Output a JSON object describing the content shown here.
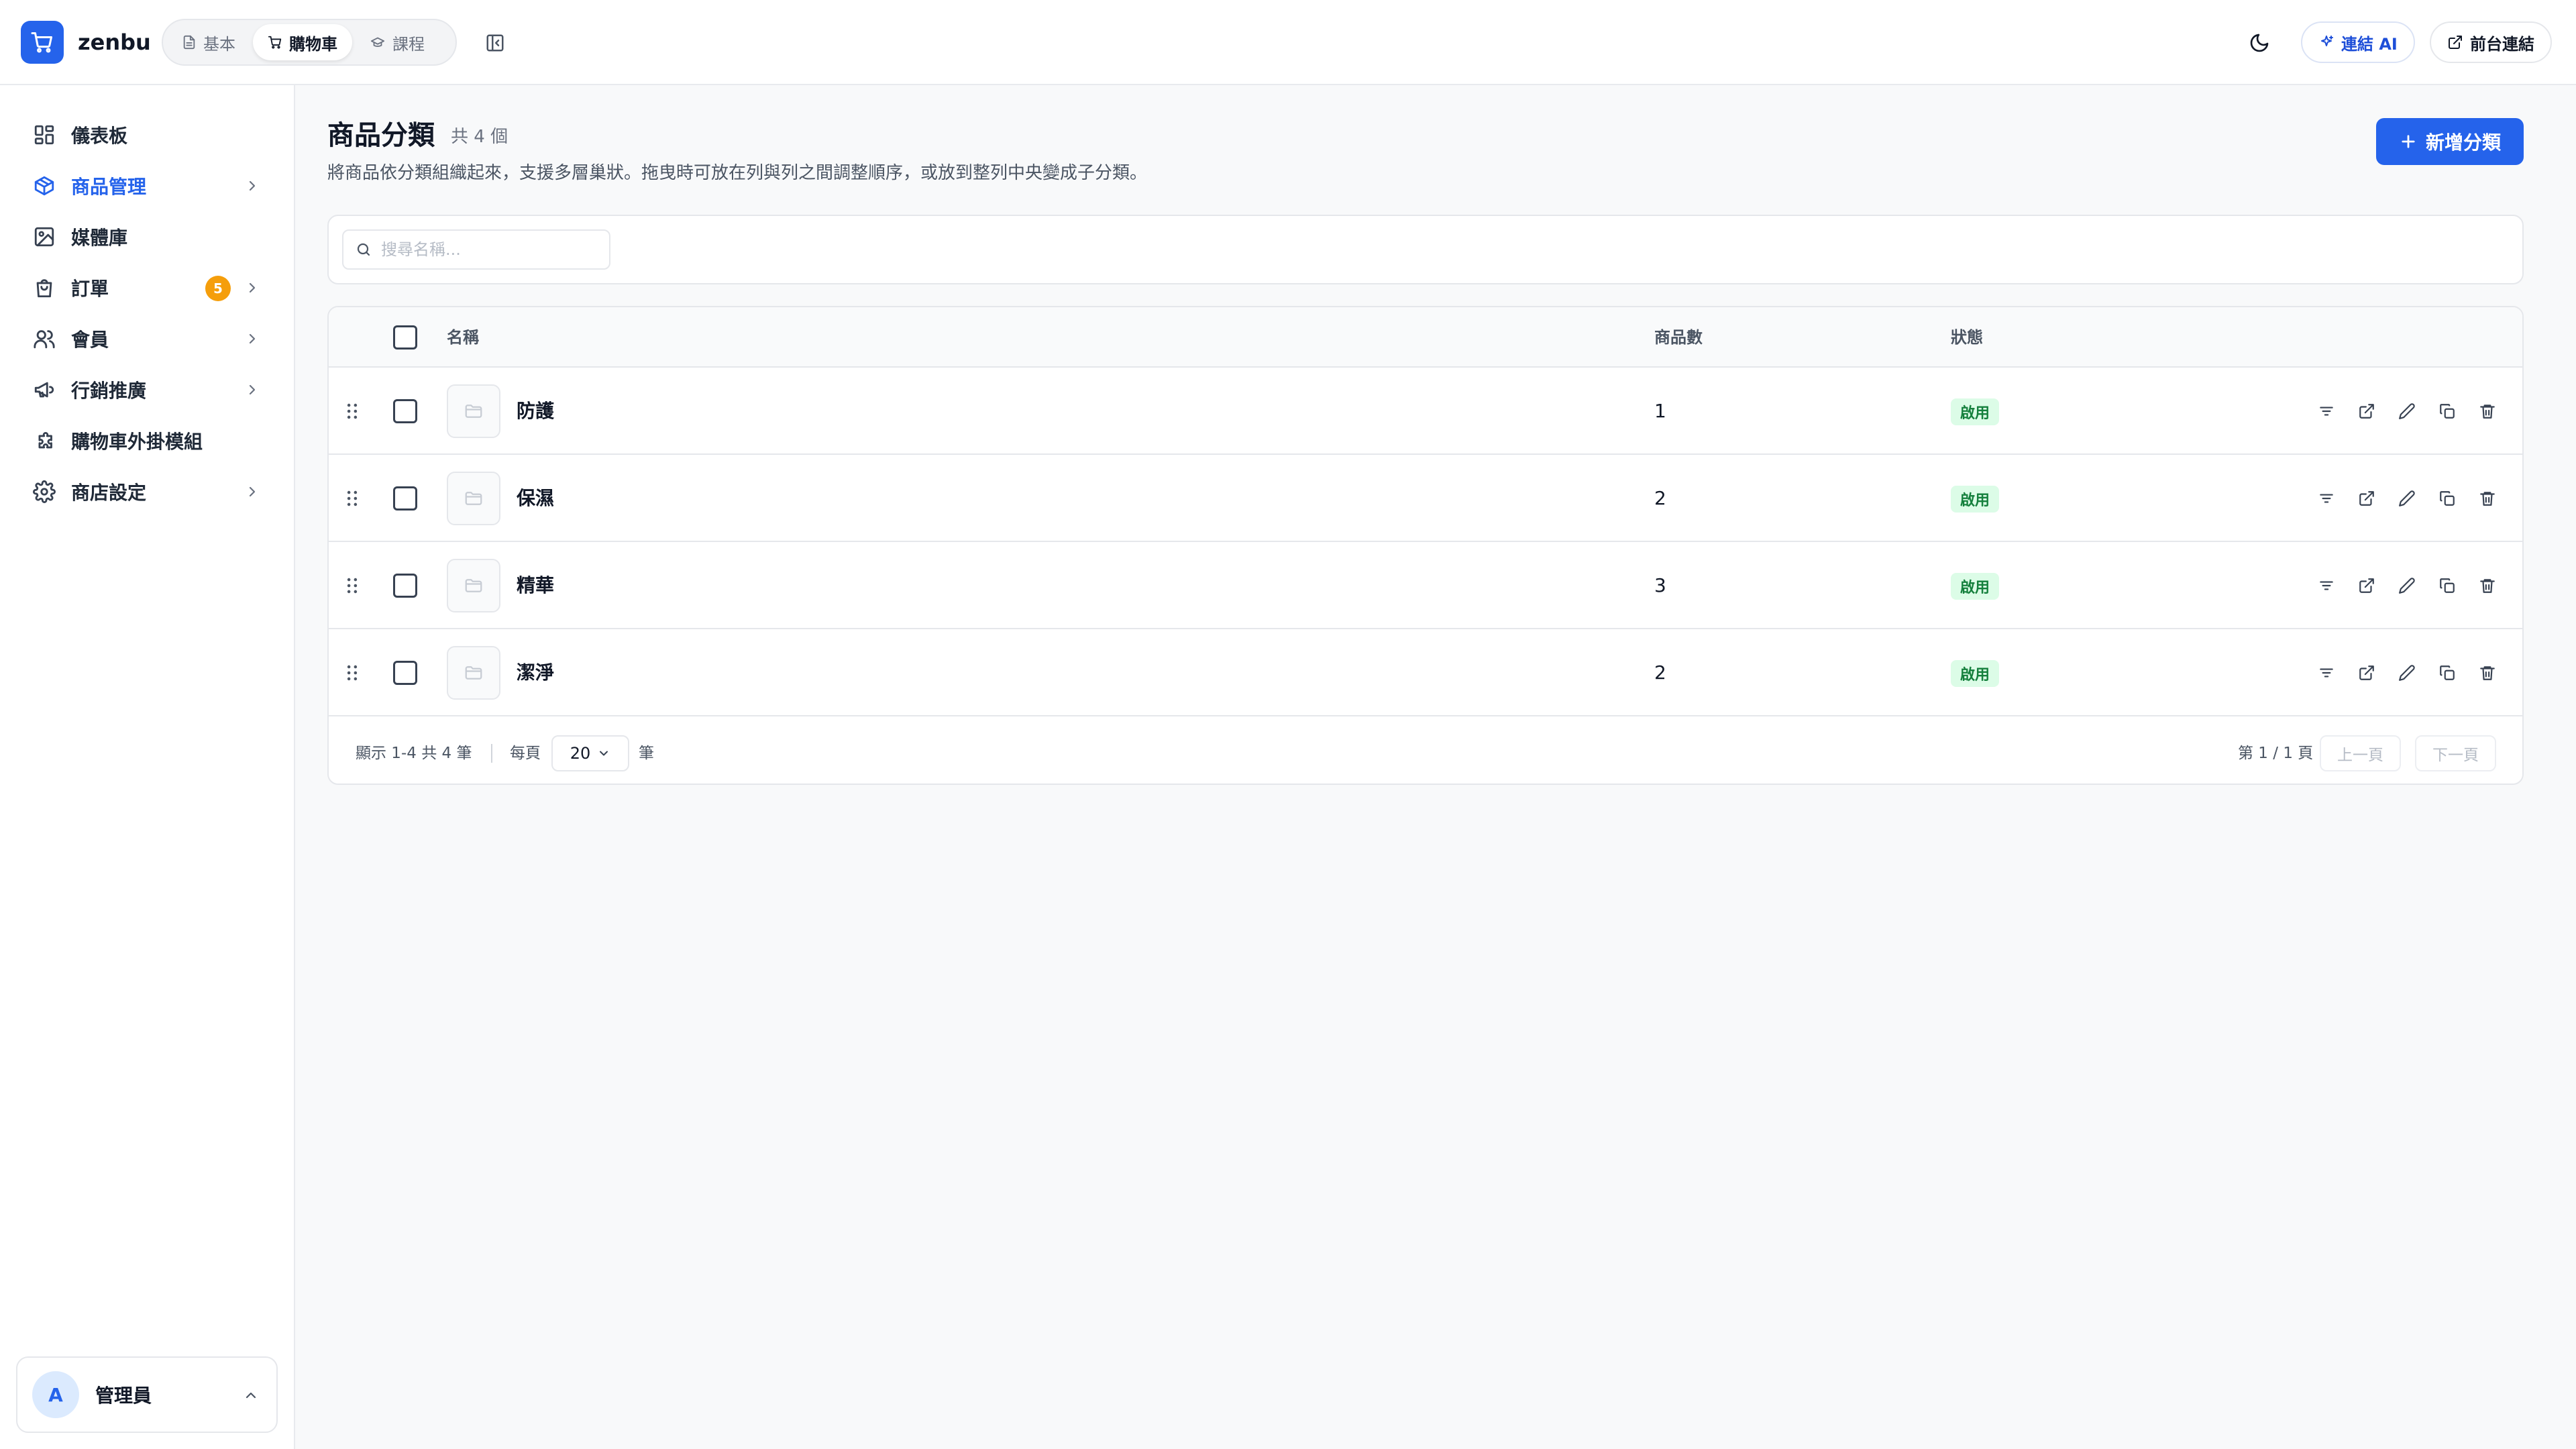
{
  "app": {
    "brand": "zenbu",
    "colors": {
      "accent": "#2563eb",
      "badge": "#f59e0b",
      "status_bg": "#dcfce7",
      "status_text": "#15803d"
    }
  },
  "header": {
    "modes": [
      {
        "label": "基本",
        "icon": "document-icon",
        "active": false
      },
      {
        "label": "購物車",
        "icon": "cart-icon",
        "active": true
      },
      {
        "label": "課程",
        "icon": "graduation-cap-icon",
        "active": false
      }
    ],
    "ai_button": "連結 AI",
    "frontend_button": "前台連結"
  },
  "sidebar": {
    "items": [
      {
        "label": "儀表板",
        "icon": "dashboard-icon",
        "active": false,
        "expandable": false
      },
      {
        "label": "商品管理",
        "icon": "box-icon",
        "active": true,
        "expandable": true
      },
      {
        "label": "媒體庫",
        "icon": "image-icon",
        "active": false,
        "expandable": false
      },
      {
        "label": "訂單",
        "icon": "bag-icon",
        "active": false,
        "expandable": true,
        "badge": "5"
      },
      {
        "label": "會員",
        "icon": "users-icon",
        "active": false,
        "expandable": true
      },
      {
        "label": "行銷推廣",
        "icon": "megaphone-icon",
        "active": false,
        "expandable": true
      },
      {
        "label": "購物車外掛模組",
        "icon": "puzzle-icon",
        "active": false,
        "expandable": false
      },
      {
        "label": "商店設定",
        "icon": "gear-icon",
        "active": false,
        "expandable": true
      }
    ],
    "user": {
      "initial": "A",
      "name": "管理員"
    }
  },
  "page": {
    "title": "商品分類",
    "count": "共 4 個",
    "description": "將商品依分類組織起來，支援多層巢狀。拖曳時可放在列與列之間調整順序，或放到整列中央變成子分類。",
    "add_button": "新增分類"
  },
  "search": {
    "placeholder": "搜尋名稱..."
  },
  "table": {
    "columns": {
      "name": "名稱",
      "count": "商品數",
      "status": "狀態"
    },
    "rows": [
      {
        "name": "防護",
        "count": "1",
        "status": "啟用"
      },
      {
        "name": "保濕",
        "count": "2",
        "status": "啟用"
      },
      {
        "name": "精華",
        "count": "3",
        "status": "啟用"
      },
      {
        "name": "潔淨",
        "count": "2",
        "status": "啟用"
      }
    ],
    "row_actions": [
      "filter-icon",
      "external-link-icon",
      "pencil-icon",
      "copy-icon",
      "trash-icon"
    ]
  },
  "pagination": {
    "summary": "顯示 1-4 共 4 筆",
    "per_page_label": "每頁",
    "per_page_value": "20",
    "per_page_unit": "筆",
    "page_info": "第 1 / 1 頁",
    "prev": "上一頁",
    "next": "下一頁"
  }
}
